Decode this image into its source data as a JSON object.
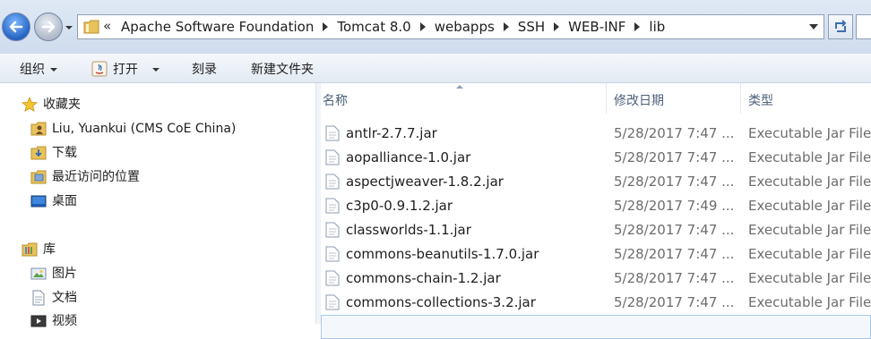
{
  "address": {
    "overflow": "«",
    "crumbs": [
      "Apache Software Foundation",
      "Tomcat 8.0",
      "webapps",
      "SSH",
      "WEB-INF",
      "lib"
    ]
  },
  "toolbar": {
    "organize": "组织",
    "open": "打开",
    "burn": "刻录",
    "new_folder": "新建文件夹"
  },
  "nav": {
    "favorites": "收藏夹",
    "user": "Liu, Yuankui (CMS CoE China)",
    "downloads": "下载",
    "recent": "最近访问的位置",
    "desktop": "桌面",
    "libraries": "库",
    "pictures": "图片",
    "documents": "文档",
    "videos": "视频"
  },
  "columns": {
    "name": "名称",
    "date": "修改日期",
    "type": "类型"
  },
  "files": [
    {
      "name": "antlr-2.7.7.jar",
      "date": "5/28/2017 7:47 ...",
      "type": "Executable Jar File"
    },
    {
      "name": "aopalliance-1.0.jar",
      "date": "5/28/2017 7:47 ...",
      "type": "Executable Jar File"
    },
    {
      "name": "aspectjweaver-1.8.2.jar",
      "date": "5/28/2017 7:47 ...",
      "type": "Executable Jar File"
    },
    {
      "name": "c3p0-0.9.1.2.jar",
      "date": "5/28/2017 7:49 ...",
      "type": "Executable Jar File"
    },
    {
      "name": "classworlds-1.1.jar",
      "date": "5/28/2017 7:47 ...",
      "type": "Executable Jar File"
    },
    {
      "name": "commons-beanutils-1.7.0.jar",
      "date": "5/28/2017 7:47 ...",
      "type": "Executable Jar File"
    },
    {
      "name": "commons-chain-1.2.jar",
      "date": "5/28/2017 7:47 ...",
      "type": "Executable Jar File"
    },
    {
      "name": "commons-collections-3.2.jar",
      "date": "5/28/2017 7:47 ...",
      "type": "Executable Jar File"
    }
  ],
  "colors": {
    "accent": "#2463c4",
    "header_text": "#4c607a",
    "muted_text": "#6d6d6d"
  }
}
